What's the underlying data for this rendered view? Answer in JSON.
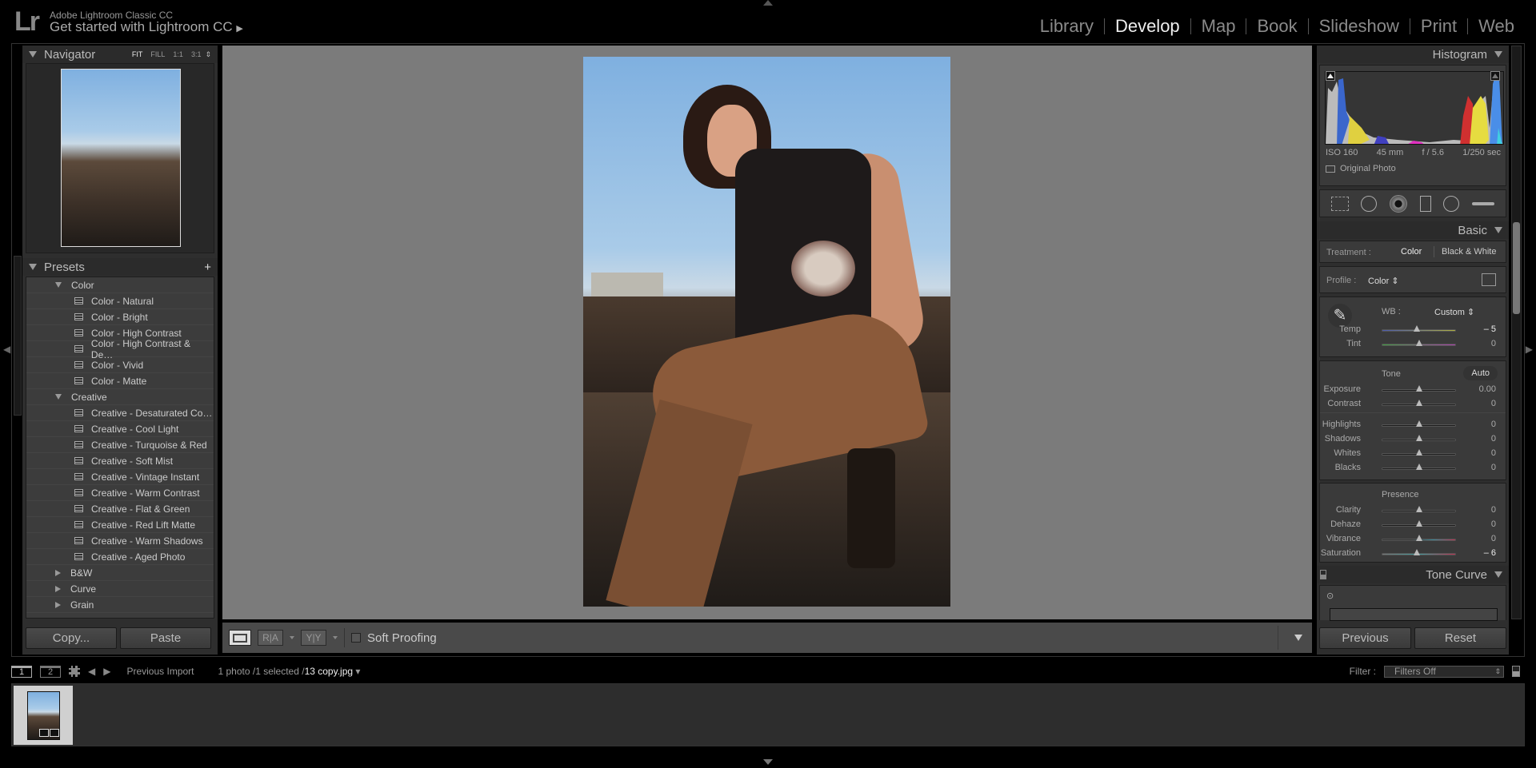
{
  "app": {
    "product": "Adobe Lightroom Classic CC",
    "title": "Get started with Lightroom CC",
    "logo": "Lr"
  },
  "modules": [
    {
      "label": "Library",
      "active": false
    },
    {
      "label": "Develop",
      "active": true
    },
    {
      "label": "Map",
      "active": false
    },
    {
      "label": "Book",
      "active": false
    },
    {
      "label": "Slideshow",
      "active": false
    },
    {
      "label": "Print",
      "active": false
    },
    {
      "label": "Web",
      "active": false
    }
  ],
  "navigator": {
    "title": "Navigator",
    "zoom_options": [
      "FIT",
      "FILL",
      "1:1",
      "3:1"
    ],
    "selected_zoom": "FIT"
  },
  "presets": {
    "title": "Presets",
    "groups": [
      {
        "name": "Color",
        "expanded": true,
        "items": [
          "Color - Natural",
          "Color - Bright",
          "Color - High Contrast",
          "Color - High Contrast & De…",
          "Color - Vivid",
          "Color - Matte"
        ]
      },
      {
        "name": "Creative",
        "expanded": true,
        "items": [
          "Creative - Desaturated Co…",
          "Creative - Cool Light",
          "Creative - Turquoise & Red",
          "Creative - Soft Mist",
          "Creative - Vintage Instant",
          "Creative - Warm Contrast",
          "Creative - Flat & Green",
          "Creative - Red Lift Matte",
          "Creative - Warm Shadows",
          "Creative - Aged Photo"
        ]
      },
      {
        "name": "B&W",
        "expanded": false,
        "items": []
      },
      {
        "name": "Curve",
        "expanded": false,
        "items": []
      },
      {
        "name": "Grain",
        "expanded": false,
        "items": []
      }
    ]
  },
  "left_buttons": {
    "copy": "Copy...",
    "paste": "Paste"
  },
  "toolbar": {
    "view_ra": "R|A",
    "view_yy": "Y|Y",
    "soft_proofing": "Soft Proofing",
    "soft_proofing_checked": false
  },
  "histogram": {
    "title": "Histogram",
    "iso": "ISO 160",
    "focal": "45 mm",
    "aperture": "f / 5.6",
    "shutter": "1/250 sec",
    "original_photo": "Original Photo"
  },
  "basic": {
    "title": "Basic",
    "treatment_label": "Treatment :",
    "treatment_options": [
      "Color",
      "Black & White"
    ],
    "treatment_selected": "Color",
    "profile_label": "Profile :",
    "profile_value": "Color",
    "wb_label": "WB :",
    "wb_value": "Custom",
    "tone_label": "Tone",
    "auto_label": "Auto",
    "presence_label": "Presence",
    "wb_sliders": [
      {
        "label": "Temp",
        "value": "– 5",
        "pos": 0.47
      },
      {
        "label": "Tint",
        "value": "0",
        "pos": 0.5
      }
    ],
    "tone_sliders": [
      {
        "label": "Exposure",
        "value": "0.00",
        "pos": 0.5
      },
      {
        "label": "Contrast",
        "value": "0",
        "pos": 0.5
      }
    ],
    "tone2_sliders": [
      {
        "label": "Highlights",
        "value": "0",
        "pos": 0.5
      },
      {
        "label": "Shadows",
        "value": "0",
        "pos": 0.5
      },
      {
        "label": "Whites",
        "value": "0",
        "pos": 0.5
      },
      {
        "label": "Blacks",
        "value": "0",
        "pos": 0.5
      }
    ],
    "presence_sliders": [
      {
        "label": "Clarity",
        "value": "0",
        "pos": 0.5
      },
      {
        "label": "Dehaze",
        "value": "0",
        "pos": 0.5
      },
      {
        "label": "Vibrance",
        "value": "0",
        "pos": 0.5
      },
      {
        "label": "Saturation",
        "value": "– 6",
        "pos": 0.47
      }
    ]
  },
  "tone_curve": {
    "title": "Tone Curve"
  },
  "right_buttons": {
    "previous": "Previous",
    "reset": "Reset"
  },
  "filmstrip": {
    "screen1": "1",
    "screen2": "2",
    "source": "Previous Import",
    "count": "1 photo /1 selected /",
    "filename": "13 copy.jpg",
    "filter_label": "Filter :",
    "filter_value": "Filters Off"
  }
}
